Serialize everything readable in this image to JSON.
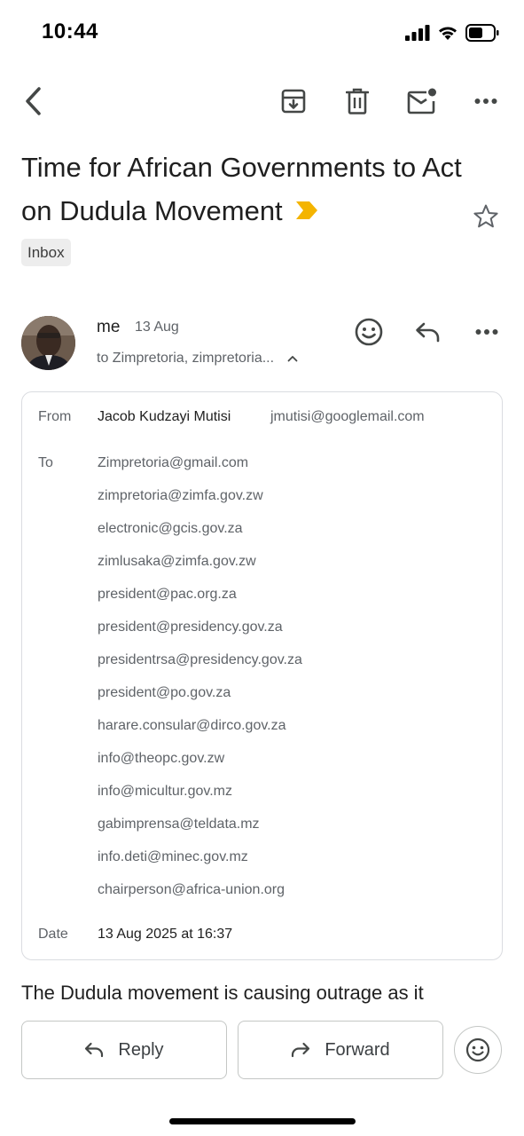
{
  "status_bar": {
    "time": "10:44"
  },
  "email": {
    "subject": "Time for African Governments to Act on Dudula Movement",
    "label": "Inbox",
    "sender_short": "me",
    "date_short": "13 Aug",
    "recipients_summary": "to Zimpretoria, zimpretoria..."
  },
  "details": {
    "from_label": "From",
    "from_name": "Jacob Kudzayi Mutisi",
    "from_email": "jmutisi@googlemail.com",
    "to_label": "To",
    "to": [
      "Zimpretoria@gmail.com",
      "zimpretoria@zimfa.gov.zw",
      "electronic@gcis.gov.za",
      "zimlusaka@zimfa.gov.zw",
      "president@pac.org.za",
      "president@presidency.gov.za",
      "presidentrsa@presidency.gov.za",
      "president@po.gov.za",
      "harare.consular@dirco.gov.za",
      "info@theopc.gov.zw",
      "info@micultur.gov.mz",
      "gabimprensa@teldata.mz",
      "info.deti@minec.gov.mz",
      "chairperson@africa-union.org"
    ],
    "date_label": "Date",
    "date_value": "13 Aug 2025 at 16:37"
  },
  "body_preview": "The Dudula movement is causing outrage as it",
  "actions": {
    "reply_label": "Reply",
    "forward_label": "Forward"
  },
  "colors": {
    "importance": "#f4b400",
    "border": "#dadce0",
    "secondary_text": "#5f6368"
  }
}
